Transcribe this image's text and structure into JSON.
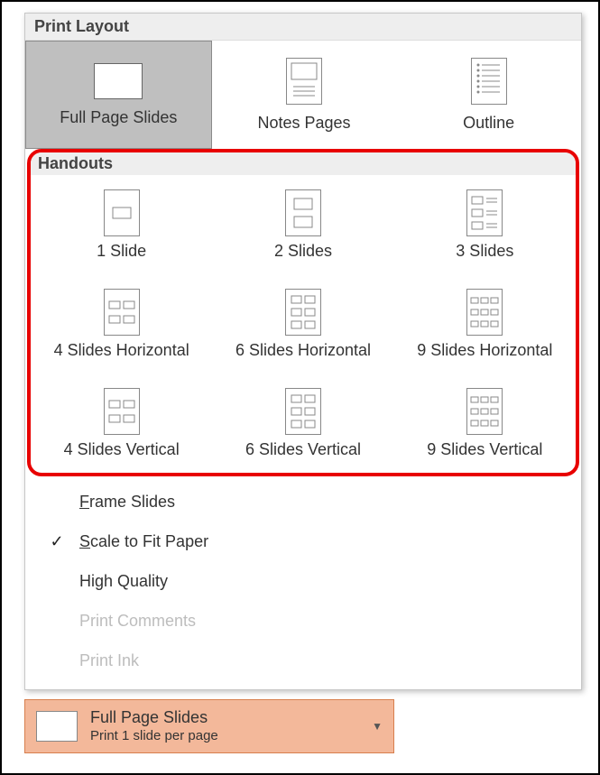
{
  "sections": {
    "print_layout_header": "Print Layout",
    "handouts_header": "Handouts"
  },
  "layouts": {
    "full_page": "Full Page Slides",
    "notes": "Notes Pages",
    "outline": "Outline"
  },
  "handouts": {
    "s1": "1 Slide",
    "s2": "2 Slides",
    "s3": "3 Slides",
    "h4": "4 Slides Horizontal",
    "h6": "6 Slides Horizontal",
    "h9": "9 Slides Horizontal",
    "v4": "4 Slides Vertical",
    "v6": "6 Slides Vertical",
    "v9": "9 Slides Vertical"
  },
  "options": {
    "frame": "rame Slides",
    "frame_u": "F",
    "scale": "cale to Fit Paper",
    "scale_u": "S",
    "highq": "High Quality",
    "comments": "Print Comments",
    "ink": "Print Ink",
    "scale_checked": "✓"
  },
  "current": {
    "title": "Full Page Slides",
    "subtitle": "Print 1 slide per page"
  }
}
